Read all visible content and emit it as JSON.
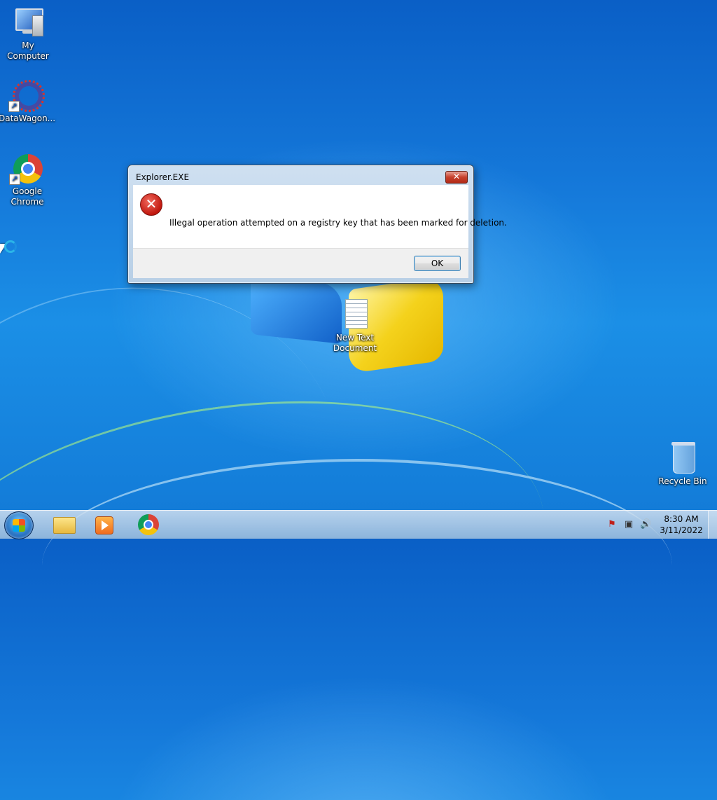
{
  "desktop": {
    "icons": [
      {
        "label": "My Computer",
        "icon": "computer-icon"
      },
      {
        "label": "DataWagon...",
        "icon": "datawagon-icon"
      },
      {
        "label": "Google Chrome",
        "icon": "chrome-icon"
      },
      {
        "label": "New Text Document",
        "icon": "text-document-icon"
      },
      {
        "label": "Recycle Bin",
        "icon": "recycle-bin-icon"
      }
    ]
  },
  "dialog": {
    "title": "Explorer.EXE",
    "close_label": "✕",
    "icon": "error-icon",
    "message": "Illegal operation attempted on a registry key that has been marked for deletion.",
    "ok_label": "OK"
  },
  "taskbar": {
    "start_icon": "windows-start-icon",
    "apps": [
      {
        "name": "Windows Explorer",
        "icon": "folder-icon"
      },
      {
        "name": "Windows Media Player",
        "icon": "media-player-icon"
      },
      {
        "name": "Google Chrome",
        "icon": "chrome-icon"
      }
    ],
    "tray": {
      "icons": [
        "action-center-flag-icon",
        "network-icon",
        "volume-icon"
      ],
      "time": "8:30 AM",
      "date": "3/11/2022"
    }
  }
}
